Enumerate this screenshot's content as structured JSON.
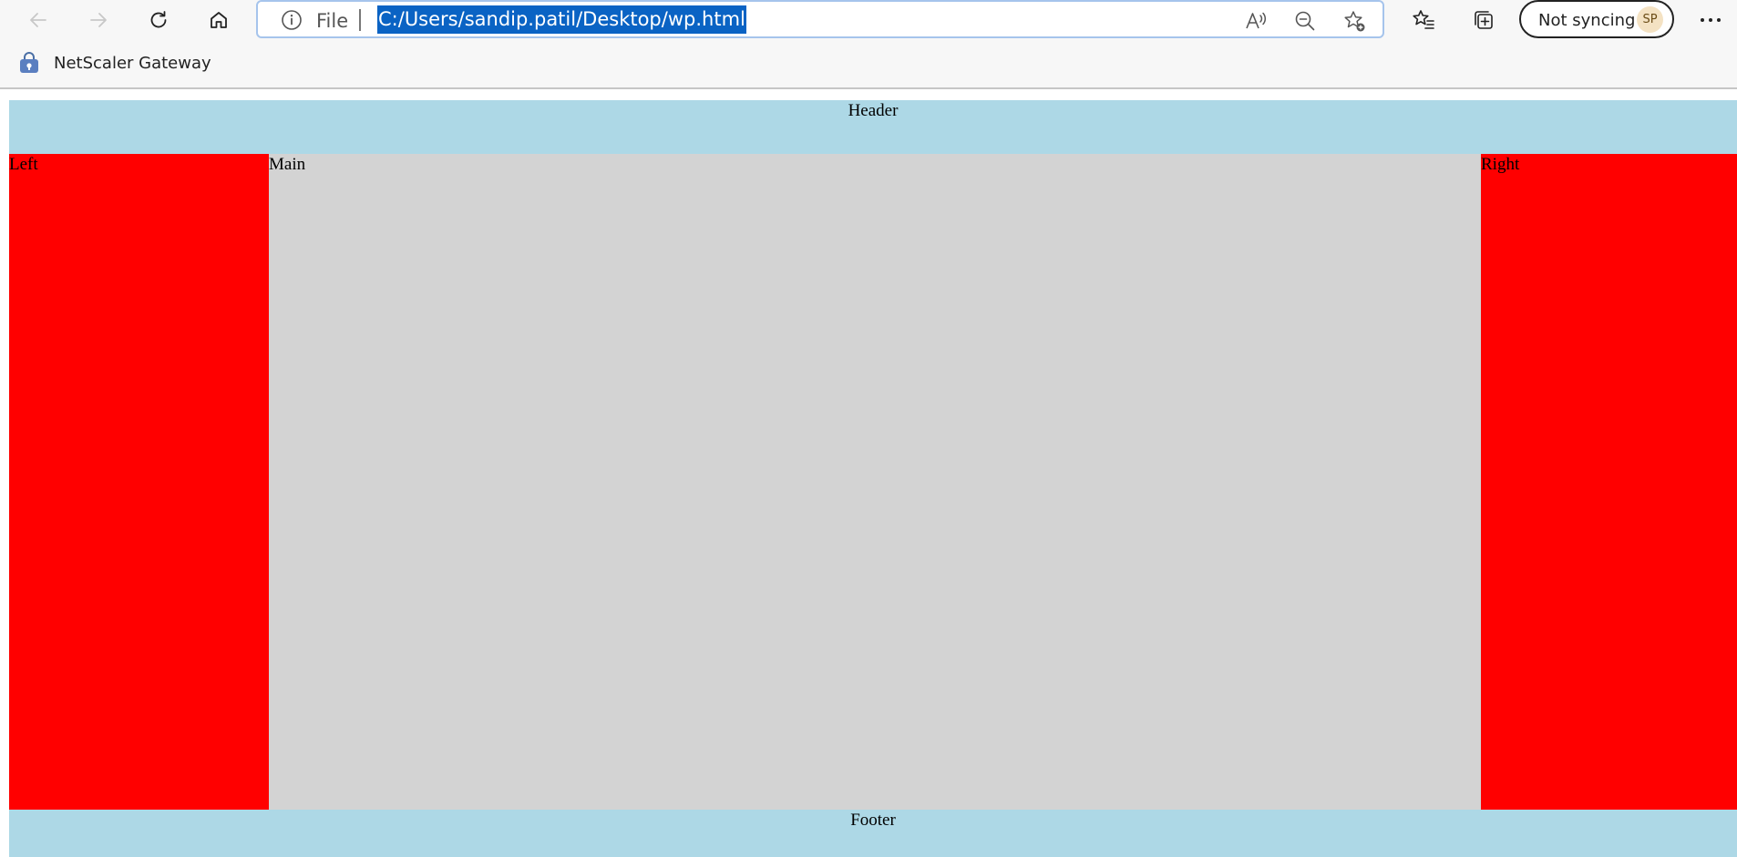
{
  "toolbar": {
    "back_icon": "back-arrow-icon",
    "forward_icon": "forward-arrow-icon",
    "refresh_icon": "refresh-icon",
    "home_icon": "home-icon",
    "address": {
      "scheme_label": "File",
      "url": "C:/Users/sandip.patil/Desktop/wp.html"
    },
    "sync": {
      "label": "Not syncing",
      "avatar_initials": "SP"
    }
  },
  "favorites": [
    {
      "label": "NetScaler Gateway",
      "icon": "lock-bag-icon"
    }
  ],
  "page": {
    "header": "Header",
    "left": "Left",
    "main": "Main",
    "right": "Right",
    "footer": "Footer"
  },
  "colors": {
    "header_footer": "#add8e6",
    "sidebars": "#ff0000",
    "main": "#d3d3d3",
    "url_highlight": "#0a63c4"
  }
}
